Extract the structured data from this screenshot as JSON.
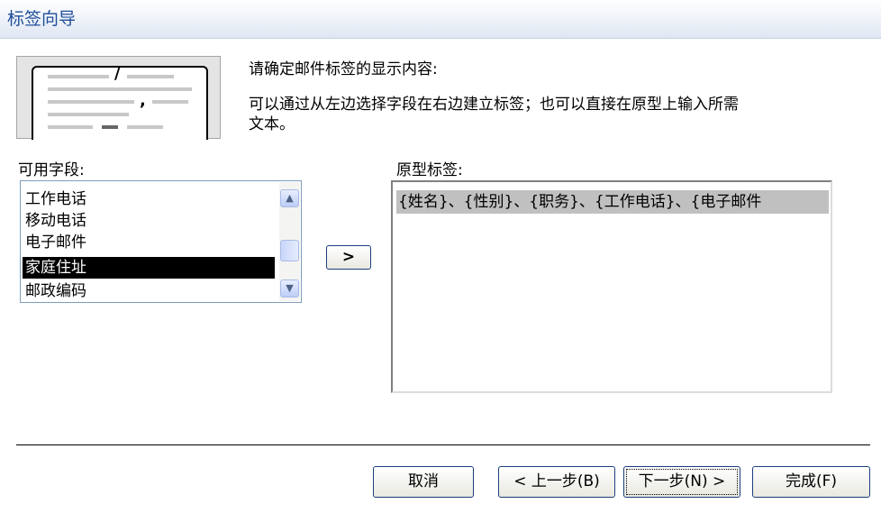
{
  "window": {
    "title": "标签向导"
  },
  "instructions": {
    "line1": "请确定邮件标签的显示内容:",
    "line2": "可以通过从左边选择字段在右边建立标签；也可以直接在原型上输入所需",
    "line3": "文本。"
  },
  "available_fields": {
    "label": "可用字段:",
    "items": [
      {
        "label": "工作电话",
        "selected": false
      },
      {
        "label": "移动电话",
        "selected": false
      },
      {
        "label": "电子邮件",
        "selected": false
      },
      {
        "label": "家庭住址",
        "selected": true
      },
      {
        "label": "邮政编码",
        "selected": false
      }
    ]
  },
  "add_button": {
    "label": ">"
  },
  "prototype": {
    "label": "原型标签:",
    "content": "{姓名}、{性别}、{职务}、{工作电话}、{电子邮件"
  },
  "footer_buttons": {
    "cancel": "取消",
    "back": "< 上一步(B)",
    "next": "下一步(N) >",
    "finish": "完成(F)"
  },
  "colors": {
    "title_text": "#1f4e9a",
    "selection_bg": "#000000",
    "prototype_highlight": "#c0c0c0"
  }
}
